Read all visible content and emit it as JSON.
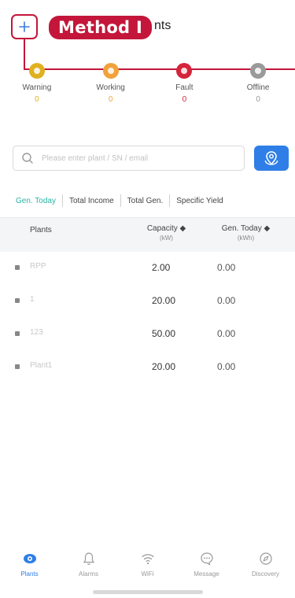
{
  "header": {
    "add_icon": "plus-icon",
    "annotation_label": "Method I",
    "title_rest": "nts",
    "annotation_color": "#c4163a"
  },
  "status": [
    {
      "label": "Warning",
      "count": "0",
      "color": "#e0b020"
    },
    {
      "label": "Working",
      "count": "0",
      "color": "#f1a23a"
    },
    {
      "label": "Fault",
      "count": "0",
      "color": "#d6243b"
    },
    {
      "label": "Offline",
      "count": "0",
      "color": "#9a9a9a"
    }
  ],
  "search": {
    "placeholder": "Please enter plant / SN / email",
    "icon": "search-icon",
    "map_button_icon": "map-icon",
    "accent": "#2f7ee8"
  },
  "tabs": [
    {
      "label": "Gen. Today",
      "active": true
    },
    {
      "label": "Total Income",
      "active": false
    },
    {
      "label": "Total Gen.",
      "active": false
    },
    {
      "label": "Specific Yield",
      "active": false
    }
  ],
  "table": {
    "col_plants": "Plants",
    "col_capacity": "Capacity ◆",
    "col_capacity_unit": "(kW)",
    "col_gen": "Gen. Today ◆",
    "col_gen_unit": "(kWh)",
    "rows": [
      {
        "name": "RPP",
        "capacity": "2.00",
        "gen": "0.00"
      },
      {
        "name": "1",
        "capacity": "20.00",
        "gen": "0.00"
      },
      {
        "name": "123",
        "capacity": "50.00",
        "gen": "0.00"
      },
      {
        "name": "Plant1",
        "capacity": "20.00",
        "gen": "0.00"
      }
    ]
  },
  "bottom_nav": [
    {
      "label": "Plants",
      "icon": "plants-icon",
      "active": true
    },
    {
      "label": "Alarms",
      "icon": "bell-icon",
      "active": false
    },
    {
      "label": "WiFi",
      "icon": "wifi-icon",
      "active": false
    },
    {
      "label": "Message",
      "icon": "message-icon",
      "active": false
    },
    {
      "label": "Discovery",
      "icon": "discovery-icon",
      "active": false
    }
  ]
}
